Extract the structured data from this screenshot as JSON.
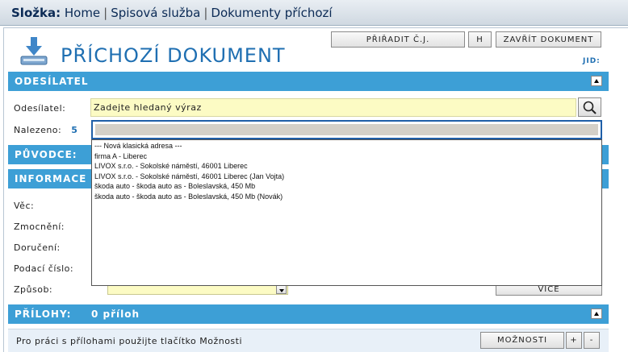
{
  "breadcrumb": {
    "folder_label": "Složka:",
    "items": [
      "Home",
      "Spisová služba",
      "Dokumenty příchozí"
    ],
    "separator": "|"
  },
  "header": {
    "title": "PŘÍCHOZÍ DOKUMENT",
    "jid_label": "JID:",
    "icon": "download-document-icon"
  },
  "toolbar": {
    "assign_label": "PŘIŘADIT Č.J.",
    "h_label": "H",
    "close_label": "ZAVŘÍT DOKUMENT"
  },
  "sender_section": {
    "title": "ODESÍLATEL",
    "sender_label": "Odesílatel:",
    "sender_placeholder": "Zadejte hledaný výraz",
    "found_label": "Nalezeno:",
    "found_count": "5",
    "search_icon": "magnifier-icon"
  },
  "dropdown": {
    "options": [
      "--- Nová klasická adresa ---",
      "firma A - Liberec",
      "LIVOX s.r.o. - Sokolské náměstí, 46001 Liberec",
      "LIVOX s.r.o. - Sokolské náměstí, 46001 Liberec (Jan Vojta)",
      "škoda auto - škoda auto as - Boleslavská, 450 Mb",
      "škoda auto - škoda auto as - Boleslavská, 450 Mb (Novák)"
    ]
  },
  "origin_section": {
    "title": "PŮVODCE:"
  },
  "info_section": {
    "title": "INFORMACE O",
    "fields": {
      "subject": "Věc:",
      "authorization": "Zmocnění:",
      "delivery": "Doručení:",
      "filing_number": "Podací číslo:",
      "method": "Způsob:"
    },
    "more_label": "VÍCE"
  },
  "attachments_section": {
    "title": "PŘÍLOHY:",
    "count_text": "0 příloh",
    "hint": "Pro práci s přílohami použijte tlačítko Možnosti",
    "options_label": "MOŽNOSTI",
    "plus_label": "+",
    "minus_label": "-"
  },
  "colors": {
    "section_blue": "#3d9fd6",
    "title_blue": "#1f6fb2",
    "input_yellow": "#fcfbc4"
  }
}
